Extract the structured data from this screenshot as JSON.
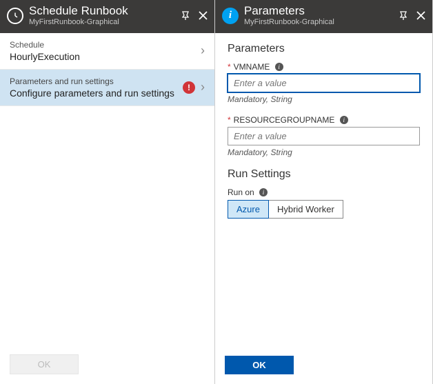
{
  "left": {
    "title": "Schedule Runbook",
    "subtitle": "MyFirstRunbook-Graphical",
    "rows": {
      "schedule": {
        "label": "Schedule",
        "value": "HourlyExecution"
      },
      "params": {
        "label": "Parameters and run settings",
        "value": "Configure parameters and run settings"
      }
    },
    "ok": "OK"
  },
  "right": {
    "title": "Parameters",
    "subtitle": "MyFirstRunbook-Graphical",
    "section_params": "Parameters",
    "fields": {
      "vmname": {
        "label": "VMNAME",
        "placeholder": "Enter a value",
        "hint": "Mandatory, String"
      },
      "rgname": {
        "label": "RESOURCEGROUPNAME",
        "placeholder": "Enter a value",
        "hint": "Mandatory, String"
      }
    },
    "section_run": "Run Settings",
    "run_on_label": "Run on",
    "toggle": {
      "azure": "Azure",
      "hybrid": "Hybrid Worker"
    },
    "ok": "OK"
  }
}
